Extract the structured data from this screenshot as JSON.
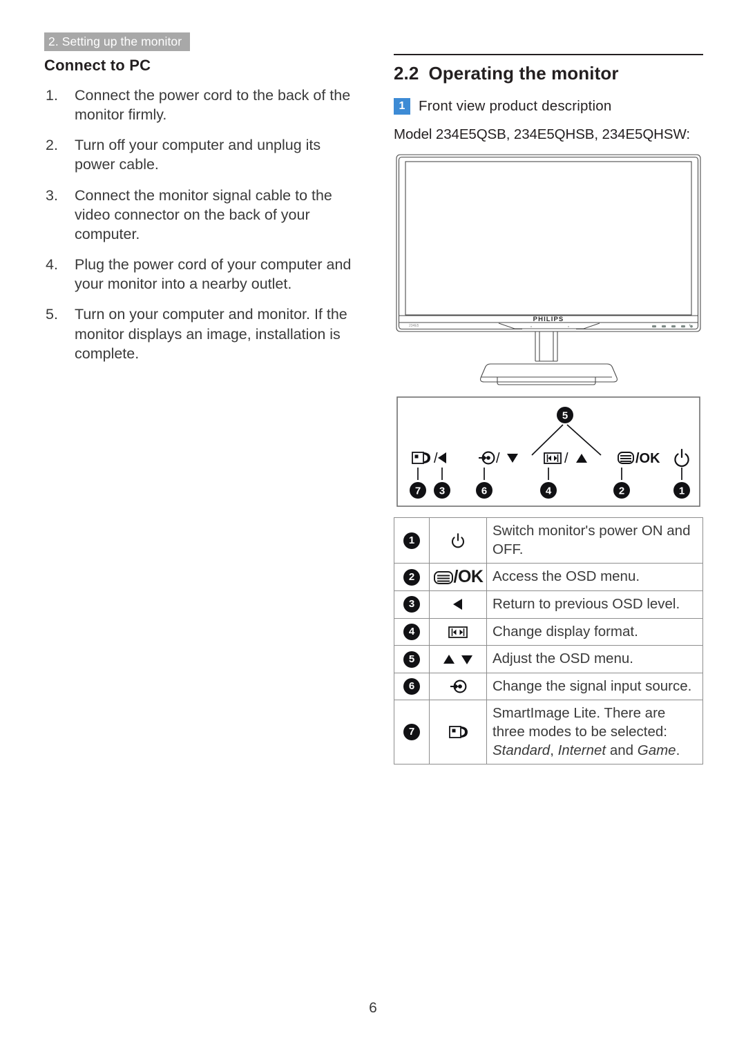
{
  "header": {
    "running_title": "2. Setting up the monitor"
  },
  "left": {
    "heading": "Connect to PC",
    "steps": [
      {
        "num": "1.",
        "text": "Connect the power cord to the back of the monitor firmly."
      },
      {
        "num": "2.",
        "text": "Turn off your computer and unplug its power cable."
      },
      {
        "num": "3.",
        "text": "Connect the monitor signal cable to the video connector on the back of your computer."
      },
      {
        "num": "4.",
        "text": "Plug the power cord of your computer and your monitor into a nearby outlet."
      },
      {
        "num": "5.",
        "text": "Turn on your computer and monitor. If the monitor displays an image,  installation is complete."
      }
    ]
  },
  "right": {
    "section_number": "2.2",
    "section_title": "Operating the monitor",
    "sub_badge": "1",
    "sub_title": "Front view product description",
    "model_line": "Model 234E5QSB, 234E5QHSB, 234E5QHSW:",
    "brand_logo": "PHILIPS",
    "bezel_model_mark": "234E5",
    "accent_blue": "#3d8bd5",
    "header_badge_gray": "#a8a8a8"
  },
  "panel": {
    "callouts": [
      {
        "id": "7",
        "label": "smartimage"
      },
      {
        "id": "3",
        "label": "back-arrow"
      },
      {
        "id": "6",
        "label": "input-source"
      },
      {
        "id": "4",
        "label": "display-format"
      },
      {
        "id": "2",
        "label": "menu-ok"
      },
      {
        "id": "1",
        "label": "power"
      }
    ],
    "top_callout": "5",
    "groups": [
      {
        "icons": "smartimage / left-arrow",
        "text": "/"
      },
      {
        "icons": "input-source / down-arrow",
        "text": "/"
      },
      {
        "icons": "display-format / up-arrow",
        "text": "/"
      },
      {
        "icons": "menu / OK",
        "text": "/OK"
      },
      {
        "icons": "power",
        "text": ""
      }
    ],
    "ok_label": "/OK"
  },
  "table": {
    "rows": [
      {
        "num": "1",
        "icon": "power-icon",
        "desc": "Switch monitor's power ON and OFF."
      },
      {
        "num": "2",
        "icon": "menu-ok-icon",
        "desc": "Access the OSD menu."
      },
      {
        "num": "3",
        "icon": "left-arrow-icon",
        "desc": "Return to previous OSD level."
      },
      {
        "num": "4",
        "icon": "display-format-icon",
        "desc": "Change display format."
      },
      {
        "num": "5",
        "icon": "up-down-arrow-icon",
        "desc": "Adjust the OSD menu."
      },
      {
        "num": "6",
        "icon": "input-source-icon",
        "desc": "Change the signal input source."
      },
      {
        "num": "7",
        "icon": "smartimage-icon",
        "desc_pre": "SmartImage Lite. There are three modes to be selected: ",
        "desc_em1": "Standard",
        "desc_mid": ", ",
        "desc_em2": "Internet",
        "desc_mid2": " and ",
        "desc_em3": "Game",
        "desc_end": "."
      }
    ],
    "ok_text": "/OK"
  },
  "footer": {
    "page_number": "6"
  }
}
